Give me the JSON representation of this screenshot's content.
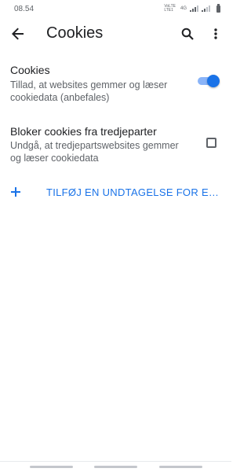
{
  "status_bar": {
    "time": "08.54",
    "network_top": "VoLTE",
    "network_bottom": "LTE1",
    "network_type": "4G"
  },
  "app_bar": {
    "title": "Cookies",
    "back_icon": "arrow-back-icon",
    "search_icon": "search-icon",
    "more_icon": "more-vert-icon"
  },
  "preferences": {
    "cookies": {
      "title": "Cookies",
      "summary": "Tillad, at websites gemmer og læser cookiedata (anbefales)",
      "enabled": true
    },
    "block_third_party": {
      "title": "Bloker cookies fra tredjeparter",
      "summary": "Undgå, at tredjepartswebsites gemmer og læser cookiedata",
      "checked": false
    }
  },
  "add_exception": {
    "label": "TILFØJ EN UNDTAGELSE FOR ET WEBSTED",
    "icon": "plus-icon"
  },
  "colors": {
    "accent": "#1a73e8",
    "text_primary": "#202124",
    "text_secondary": "#5f6368"
  }
}
